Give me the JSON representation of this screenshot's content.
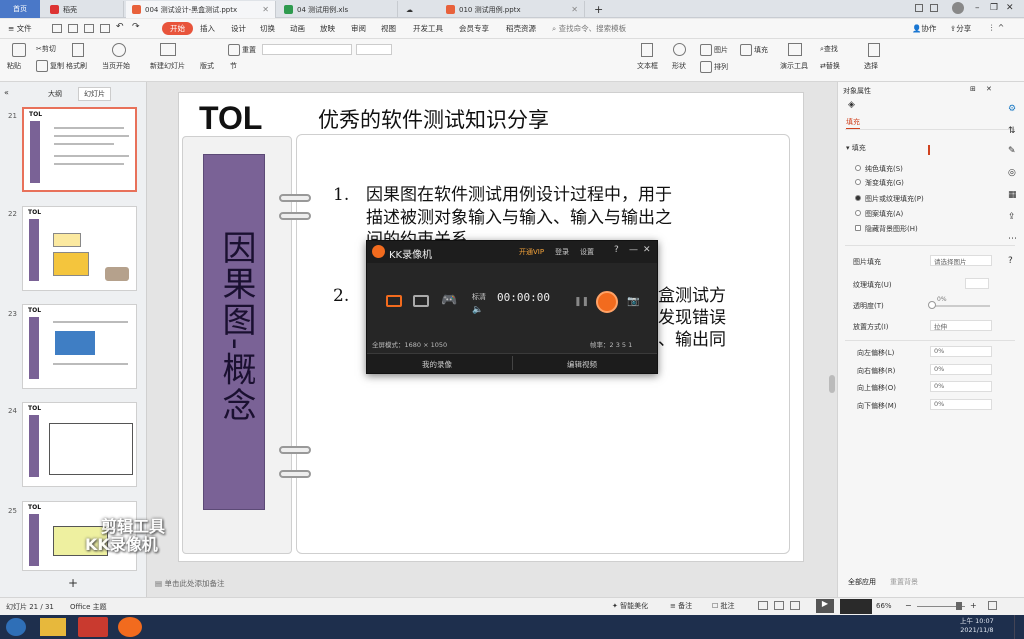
{
  "tabs": {
    "home": "首页",
    "tab1": "稻壳",
    "tab2": "004 测试设计-黑盒测试.pptx",
    "tab3": "04 测试用例.xls",
    "tab4": "010 测试用例.pptx"
  },
  "titlebar": {
    "collab": "协作",
    "share": "分享"
  },
  "menubar": {
    "file": "文件",
    "items": [
      "开始",
      "插入",
      "设计",
      "切换",
      "动画",
      "放映",
      "审阅",
      "视图",
      "开发工具",
      "会员专享",
      "稻壳资源"
    ],
    "search": "查找命令、搜索模板"
  },
  "ribbon": {
    "paste": "粘贴",
    "cut": "剪切",
    "copy": "复制",
    "format_painter": "格式刷",
    "play": "当页开始",
    "new_slide": "新建幻灯片",
    "layout": "版式",
    "section": "节",
    "reset": "重置",
    "textbox": "文本框",
    "shape": "形状",
    "picture": "图片",
    "arrange": "排列",
    "fill": "填充",
    "presenter": "演示工具",
    "find": "查找",
    "replace": "替换",
    "select": "选择"
  },
  "leftpanel": {
    "tab_outline": "大纲",
    "tab_slides": "幻灯片",
    "nums": [
      "21",
      "22",
      "23",
      "24",
      "25"
    ],
    "thumb_title": "TOL",
    "add": "+"
  },
  "slide": {
    "title": "TOL",
    "subtitle": "优秀的软件测试知识分享",
    "vertical_text": "因果图-概念",
    "p1_num": "1.",
    "p1_line1": "因果图在软件测试用例设计过程中，用于",
    "p1_line2": "描述被测对象输入与输入、输入与输出之",
    "p1_line3": "间的约束关系",
    "p2_num": "2.",
    "p2_line1": "盒测试方",
    "p2_line2": "发现错误",
    "p2_line3": "、输出同",
    "notes": "单击此处添加备注"
  },
  "recorder": {
    "title": "KK录像机",
    "open": "开通VIP",
    "login": "登录",
    "settings": "设置",
    "help": "?",
    "minimize": "—",
    "close": "✕",
    "quality": "标清",
    "timer": "00:00:00",
    "fullscreen": "全屏模式：1680 × 1050",
    "framerate": "帧率：2 3 5 1",
    "my_videos": "我的录像",
    "edit_video": "编辑视频"
  },
  "watermark": {
    "line1": "剪辑工具",
    "line2": "KK录像机"
  },
  "rightpanel": {
    "title": "对象属性",
    "fill_tab": "填充",
    "section_fill": "填充",
    "opts": [
      "纯色填充(S)",
      "渐变填充(G)",
      "图片或纹理填充(P)",
      "图案填充(A)",
      "隐藏背景图形(H)"
    ],
    "selected_opt": 2,
    "pic_fill_label": "图片填充",
    "pic_fill_value": "请选择图片",
    "texture_label": "纹理填充(U)",
    "transparency_label": "透明度(T)",
    "transparency_value": "0%",
    "place_label": "放置方式(I)",
    "place_value": "拉伸",
    "offsets": [
      {
        "label": "向左偏移(L)",
        "value": "0%"
      },
      {
        "label": "向右偏移(R)",
        "value": "0%"
      },
      {
        "label": "向上偏移(O)",
        "value": "0%"
      },
      {
        "label": "向下偏移(M)",
        "value": "0%"
      }
    ],
    "apply_all": "全部应用",
    "reset_bg": "重置背景"
  },
  "statusbar": {
    "slide_info": "幻灯片 21 / 31",
    "theme": "Office 主题",
    "smart": "智能美化",
    "notes": "备注",
    "comments": "批注",
    "zoom": "66%"
  },
  "taskbar": {
    "time": "上午 10:07",
    "date": "2021/11/8"
  }
}
